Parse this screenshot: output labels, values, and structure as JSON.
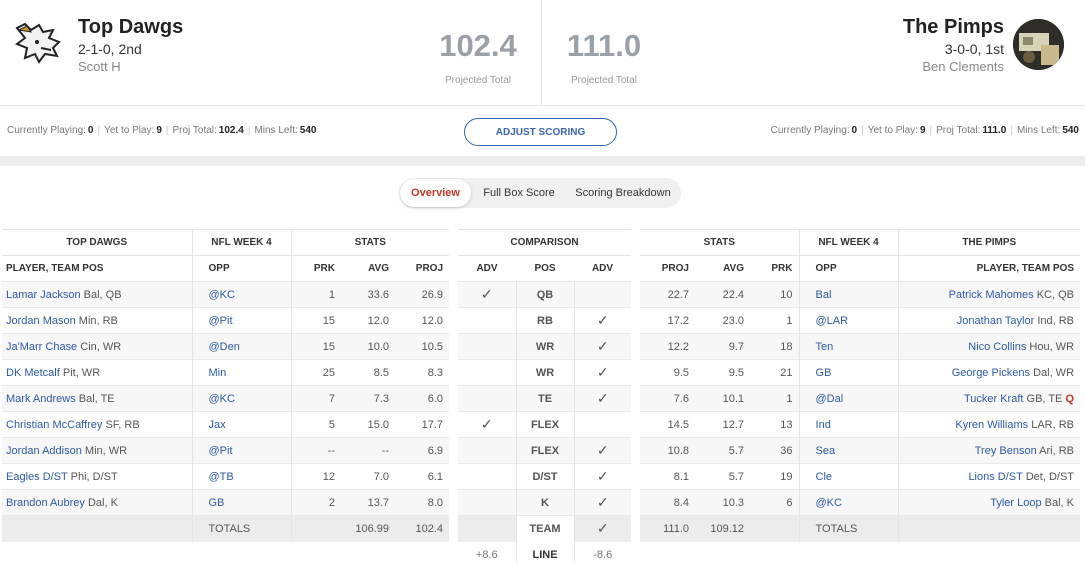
{
  "home": {
    "name": "Top Dawgs",
    "record": "2-1-0, 2nd",
    "owner": "Scott H",
    "projected": "102.4",
    "projected_label": "Projected Total",
    "stats": {
      "playing_label": "Currently Playing:",
      "playing": "0",
      "ytp_label": "Yet to Play:",
      "ytp": "9",
      "proj_label": "Proj Total:",
      "proj": "102.4",
      "mins_label": "Mins Left:",
      "mins": "540"
    }
  },
  "away": {
    "name": "The Pimps",
    "record": "3-0-0, 1st",
    "owner": "Ben Clements",
    "projected": "111.0",
    "projected_label": "Projected Total",
    "stats": {
      "playing_label": "Currently Playing:",
      "playing": "0",
      "ytp_label": "Yet to Play:",
      "ytp": "9",
      "proj_label": "Proj Total:",
      "proj": "111.0",
      "mins_label": "Mins Left:",
      "mins": "540"
    }
  },
  "adjust_scoring": "ADJUST SCORING",
  "tabs": [
    "Overview",
    "Full Box Score",
    "Scoring Breakdown"
  ],
  "headers": {
    "top_dawgs": "TOP DAWGS",
    "week": "NFL WEEK 4",
    "stats": "STATS",
    "comparison": "COMPARISON",
    "the_pimps": "THE PIMPS",
    "player_team_pos": "PLAYER, TEAM POS",
    "opp": "OPP",
    "prk": "PRK",
    "avg": "AVG",
    "proj": "PROJ",
    "adv": "ADV",
    "pos": "POS"
  },
  "left_rows": [
    {
      "name": "Lamar Jackson",
      "team": "Bal, QB",
      "opp": "@KC",
      "prk": "1",
      "avg": "33.6",
      "proj": "26.9"
    },
    {
      "name": "Jordan Mason",
      "team": "Min, RB",
      "opp": "@Pit",
      "prk": "15",
      "avg": "12.0",
      "proj": "12.0"
    },
    {
      "name": "Ja'Marr Chase",
      "team": "Cin, WR",
      "opp": "@Den",
      "prk": "15",
      "avg": "10.0",
      "proj": "10.5"
    },
    {
      "name": "DK Metcalf",
      "team": "Pit, WR",
      "opp": "Min",
      "prk": "25",
      "avg": "8.5",
      "proj": "8.3"
    },
    {
      "name": "Mark Andrews",
      "team": "Bal, TE",
      "opp": "@KC",
      "prk": "7",
      "avg": "7.3",
      "proj": "6.0"
    },
    {
      "name": "Christian McCaffrey",
      "team": "SF, RB",
      "opp": "Jax",
      "prk": "5",
      "avg": "15.0",
      "proj": "17.7"
    },
    {
      "name": "Jordan Addison",
      "team": "Min, WR",
      "opp": "@Pit",
      "prk": "--",
      "avg": "--",
      "proj": "6.9"
    },
    {
      "name": "Eagles D/ST",
      "team": "Phi, D/ST",
      "opp": "@TB",
      "prk": "12",
      "avg": "7.0",
      "proj": "6.1"
    },
    {
      "name": "Brandon Aubrey",
      "team": "Dal, K",
      "opp": "GB",
      "prk": "2",
      "avg": "13.7",
      "proj": "8.0"
    }
  ],
  "left_totals": {
    "label": "TOTALS",
    "avg": "106.99",
    "proj": "102.4"
  },
  "comparison_rows": [
    {
      "pos": "QB",
      "adv_left": true,
      "adv_right": false
    },
    {
      "pos": "RB",
      "adv_left": false,
      "adv_right": true
    },
    {
      "pos": "WR",
      "adv_left": false,
      "adv_right": true
    },
    {
      "pos": "WR",
      "adv_left": false,
      "adv_right": true
    },
    {
      "pos": "TE",
      "adv_left": false,
      "adv_right": true
    },
    {
      "pos": "FLEX",
      "adv_left": true,
      "adv_right": false
    },
    {
      "pos": "FLEX",
      "adv_left": false,
      "adv_right": true
    },
    {
      "pos": "D/ST",
      "adv_left": false,
      "adv_right": true
    },
    {
      "pos": "K",
      "adv_left": false,
      "adv_right": true
    },
    {
      "pos": "TEAM",
      "adv_left": false,
      "adv_right": true
    }
  ],
  "line": {
    "label": "LINE",
    "left": "+8.6",
    "right": "-8.6"
  },
  "right_rows": [
    {
      "proj": "22.7",
      "avg": "22.4",
      "prk": "10",
      "opp": "Bal",
      "name": "Patrick Mahomes",
      "team": "KC, QB",
      "status": ""
    },
    {
      "proj": "17.2",
      "avg": "23.0",
      "prk": "1",
      "opp": "@LAR",
      "name": "Jonathan Taylor",
      "team": "Ind, RB",
      "status": ""
    },
    {
      "proj": "12.2",
      "avg": "9.7",
      "prk": "18",
      "opp": "Ten",
      "name": "Nico Collins",
      "team": "Hou, WR",
      "status": ""
    },
    {
      "proj": "9.5",
      "avg": "9.5",
      "prk": "21",
      "opp": "GB",
      "name": "George Pickens",
      "team": "Dal, WR",
      "status": ""
    },
    {
      "proj": "7.6",
      "avg": "10.1",
      "prk": "1",
      "opp": "@Dal",
      "name": "Tucker Kraft",
      "team": "GB, TE",
      "status": "Q"
    },
    {
      "proj": "14.5",
      "avg": "12.7",
      "prk": "13",
      "opp": "Ind",
      "name": "Kyren Williams",
      "team": "LAR, RB",
      "status": ""
    },
    {
      "proj": "10.8",
      "avg": "5.7",
      "prk": "36",
      "opp": "Sea",
      "name": "Trey Benson",
      "team": "Ari, RB",
      "status": ""
    },
    {
      "proj": "8.1",
      "avg": "5.7",
      "prk": "19",
      "opp": "Cle",
      "name": "Lions D/ST",
      "team": "Det, D/ST",
      "status": ""
    },
    {
      "proj": "8.4",
      "avg": "10.3",
      "prk": "6",
      "opp": "@KC",
      "name": "Tyler Loop",
      "team": "Bal, K",
      "status": ""
    }
  ],
  "right_totals": {
    "label": "TOTALS",
    "proj": "111.0",
    "avg": "109.12"
  },
  "colors": {
    "link": "#2c5aa0",
    "accent": "#3a64b0",
    "check": "#3aa655",
    "active_tab": "#c0392b"
  }
}
